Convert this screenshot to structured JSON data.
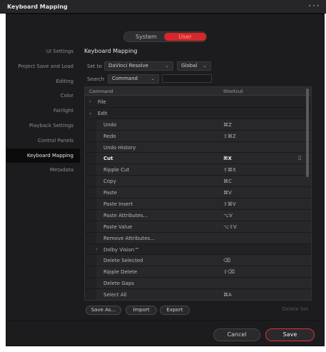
{
  "window": {
    "title": "Keyboard Mapping",
    "menu_icon": "more-dots-icon"
  },
  "segmented": {
    "options": [
      "System",
      "User"
    ],
    "selected": "User"
  },
  "sidebar": {
    "items": [
      {
        "label": "UI Settings"
      },
      {
        "label": "Project Save and Load"
      },
      {
        "label": "Editing"
      },
      {
        "label": "Color"
      },
      {
        "label": "Fairlight"
      },
      {
        "label": "Playback Settings"
      },
      {
        "label": "Control Panels"
      },
      {
        "label": "Keyboard Mapping",
        "active": true
      },
      {
        "label": "Metadata"
      }
    ]
  },
  "main": {
    "title": "Keyboard Mapping",
    "set_to_label": "Set to",
    "set_to_value": "DaVinci Resolve",
    "scope_value": "Global",
    "search_label": "Search",
    "search_value": "Command",
    "search_query": "",
    "table": {
      "headers": {
        "command": "Command",
        "shortcut": "Shortcut"
      },
      "rows": [
        {
          "command": "File",
          "shortcut": "",
          "type": "group",
          "expanded": false
        },
        {
          "command": "Edit",
          "shortcut": "",
          "type": "group",
          "expanded": true
        },
        {
          "command": "Undo",
          "shortcut": "⌘Z",
          "type": "item"
        },
        {
          "command": "Redo",
          "shortcut": "⇧⌘Z",
          "type": "item"
        },
        {
          "command": "Undo History",
          "shortcut": "",
          "type": "item"
        },
        {
          "command": "Cut",
          "shortcut": "⌘X",
          "type": "item",
          "selected": true
        },
        {
          "command": "Ripple Cut",
          "shortcut": "⇧⌘X",
          "type": "item"
        },
        {
          "command": "Copy",
          "shortcut": "⌘C",
          "type": "item"
        },
        {
          "command": "Paste",
          "shortcut": "⌘V",
          "type": "item"
        },
        {
          "command": "Paste Insert",
          "shortcut": "⇧⌘V",
          "type": "item"
        },
        {
          "command": "Paste Attributes...",
          "shortcut": "⌥V",
          "type": "item"
        },
        {
          "command": "Paste Value",
          "shortcut": "⌥⇧V",
          "type": "item"
        },
        {
          "command": "Remove Attributes...",
          "shortcut": "",
          "type": "item"
        },
        {
          "command": "Dolby Vision™",
          "shortcut": "",
          "type": "subgroup",
          "expanded": false
        },
        {
          "command": "Delete Selected",
          "shortcut": "⌫",
          "type": "item"
        },
        {
          "command": "Ripple Delete",
          "shortcut": "⇧⌫",
          "type": "item"
        },
        {
          "command": "Delete Gaps",
          "shortcut": "",
          "type": "item"
        },
        {
          "command": "Select All",
          "shortcut": "⌘A",
          "type": "item"
        }
      ]
    },
    "buttons": {
      "save_as": "Save As...",
      "import": "Import",
      "export": "Export",
      "delete_set": "Delete Set"
    }
  },
  "footer": {
    "cancel": "Cancel",
    "save": "Save"
  },
  "colors": {
    "accent": "#d8262a",
    "background": "#1c1c1e",
    "selected_row_text": "#f2f2f2"
  }
}
